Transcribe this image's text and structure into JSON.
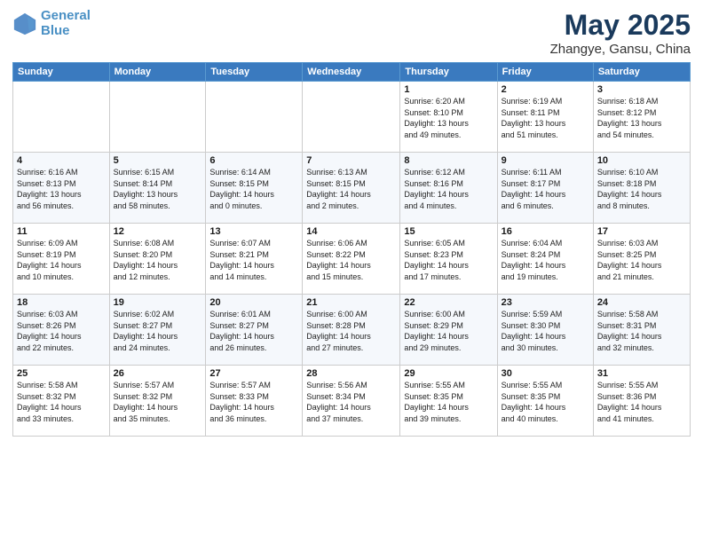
{
  "header": {
    "logo_line1": "General",
    "logo_line2": "Blue",
    "title": "May 2025",
    "subtitle": "Zhangye, Gansu, China"
  },
  "days_of_week": [
    "Sunday",
    "Monday",
    "Tuesday",
    "Wednesday",
    "Thursday",
    "Friday",
    "Saturday"
  ],
  "weeks": [
    [
      {
        "day": "",
        "info": ""
      },
      {
        "day": "",
        "info": ""
      },
      {
        "day": "",
        "info": ""
      },
      {
        "day": "",
        "info": ""
      },
      {
        "day": "1",
        "info": "Sunrise: 6:20 AM\nSunset: 8:10 PM\nDaylight: 13 hours\nand 49 minutes."
      },
      {
        "day": "2",
        "info": "Sunrise: 6:19 AM\nSunset: 8:11 PM\nDaylight: 13 hours\nand 51 minutes."
      },
      {
        "day": "3",
        "info": "Sunrise: 6:18 AM\nSunset: 8:12 PM\nDaylight: 13 hours\nand 54 minutes."
      }
    ],
    [
      {
        "day": "4",
        "info": "Sunrise: 6:16 AM\nSunset: 8:13 PM\nDaylight: 13 hours\nand 56 minutes."
      },
      {
        "day": "5",
        "info": "Sunrise: 6:15 AM\nSunset: 8:14 PM\nDaylight: 13 hours\nand 58 minutes."
      },
      {
        "day": "6",
        "info": "Sunrise: 6:14 AM\nSunset: 8:15 PM\nDaylight: 14 hours\nand 0 minutes."
      },
      {
        "day": "7",
        "info": "Sunrise: 6:13 AM\nSunset: 8:15 PM\nDaylight: 14 hours\nand 2 minutes."
      },
      {
        "day": "8",
        "info": "Sunrise: 6:12 AM\nSunset: 8:16 PM\nDaylight: 14 hours\nand 4 minutes."
      },
      {
        "day": "9",
        "info": "Sunrise: 6:11 AM\nSunset: 8:17 PM\nDaylight: 14 hours\nand 6 minutes."
      },
      {
        "day": "10",
        "info": "Sunrise: 6:10 AM\nSunset: 8:18 PM\nDaylight: 14 hours\nand 8 minutes."
      }
    ],
    [
      {
        "day": "11",
        "info": "Sunrise: 6:09 AM\nSunset: 8:19 PM\nDaylight: 14 hours\nand 10 minutes."
      },
      {
        "day": "12",
        "info": "Sunrise: 6:08 AM\nSunset: 8:20 PM\nDaylight: 14 hours\nand 12 minutes."
      },
      {
        "day": "13",
        "info": "Sunrise: 6:07 AM\nSunset: 8:21 PM\nDaylight: 14 hours\nand 14 minutes."
      },
      {
        "day": "14",
        "info": "Sunrise: 6:06 AM\nSunset: 8:22 PM\nDaylight: 14 hours\nand 15 minutes."
      },
      {
        "day": "15",
        "info": "Sunrise: 6:05 AM\nSunset: 8:23 PM\nDaylight: 14 hours\nand 17 minutes."
      },
      {
        "day": "16",
        "info": "Sunrise: 6:04 AM\nSunset: 8:24 PM\nDaylight: 14 hours\nand 19 minutes."
      },
      {
        "day": "17",
        "info": "Sunrise: 6:03 AM\nSunset: 8:25 PM\nDaylight: 14 hours\nand 21 minutes."
      }
    ],
    [
      {
        "day": "18",
        "info": "Sunrise: 6:03 AM\nSunset: 8:26 PM\nDaylight: 14 hours\nand 22 minutes."
      },
      {
        "day": "19",
        "info": "Sunrise: 6:02 AM\nSunset: 8:27 PM\nDaylight: 14 hours\nand 24 minutes."
      },
      {
        "day": "20",
        "info": "Sunrise: 6:01 AM\nSunset: 8:27 PM\nDaylight: 14 hours\nand 26 minutes."
      },
      {
        "day": "21",
        "info": "Sunrise: 6:00 AM\nSunset: 8:28 PM\nDaylight: 14 hours\nand 27 minutes."
      },
      {
        "day": "22",
        "info": "Sunrise: 6:00 AM\nSunset: 8:29 PM\nDaylight: 14 hours\nand 29 minutes."
      },
      {
        "day": "23",
        "info": "Sunrise: 5:59 AM\nSunset: 8:30 PM\nDaylight: 14 hours\nand 30 minutes."
      },
      {
        "day": "24",
        "info": "Sunrise: 5:58 AM\nSunset: 8:31 PM\nDaylight: 14 hours\nand 32 minutes."
      }
    ],
    [
      {
        "day": "25",
        "info": "Sunrise: 5:58 AM\nSunset: 8:32 PM\nDaylight: 14 hours\nand 33 minutes."
      },
      {
        "day": "26",
        "info": "Sunrise: 5:57 AM\nSunset: 8:32 PM\nDaylight: 14 hours\nand 35 minutes."
      },
      {
        "day": "27",
        "info": "Sunrise: 5:57 AM\nSunset: 8:33 PM\nDaylight: 14 hours\nand 36 minutes."
      },
      {
        "day": "28",
        "info": "Sunrise: 5:56 AM\nSunset: 8:34 PM\nDaylight: 14 hours\nand 37 minutes."
      },
      {
        "day": "29",
        "info": "Sunrise: 5:55 AM\nSunset: 8:35 PM\nDaylight: 14 hours\nand 39 minutes."
      },
      {
        "day": "30",
        "info": "Sunrise: 5:55 AM\nSunset: 8:35 PM\nDaylight: 14 hours\nand 40 minutes."
      },
      {
        "day": "31",
        "info": "Sunrise: 5:55 AM\nSunset: 8:36 PM\nDaylight: 14 hours\nand 41 minutes."
      }
    ]
  ]
}
